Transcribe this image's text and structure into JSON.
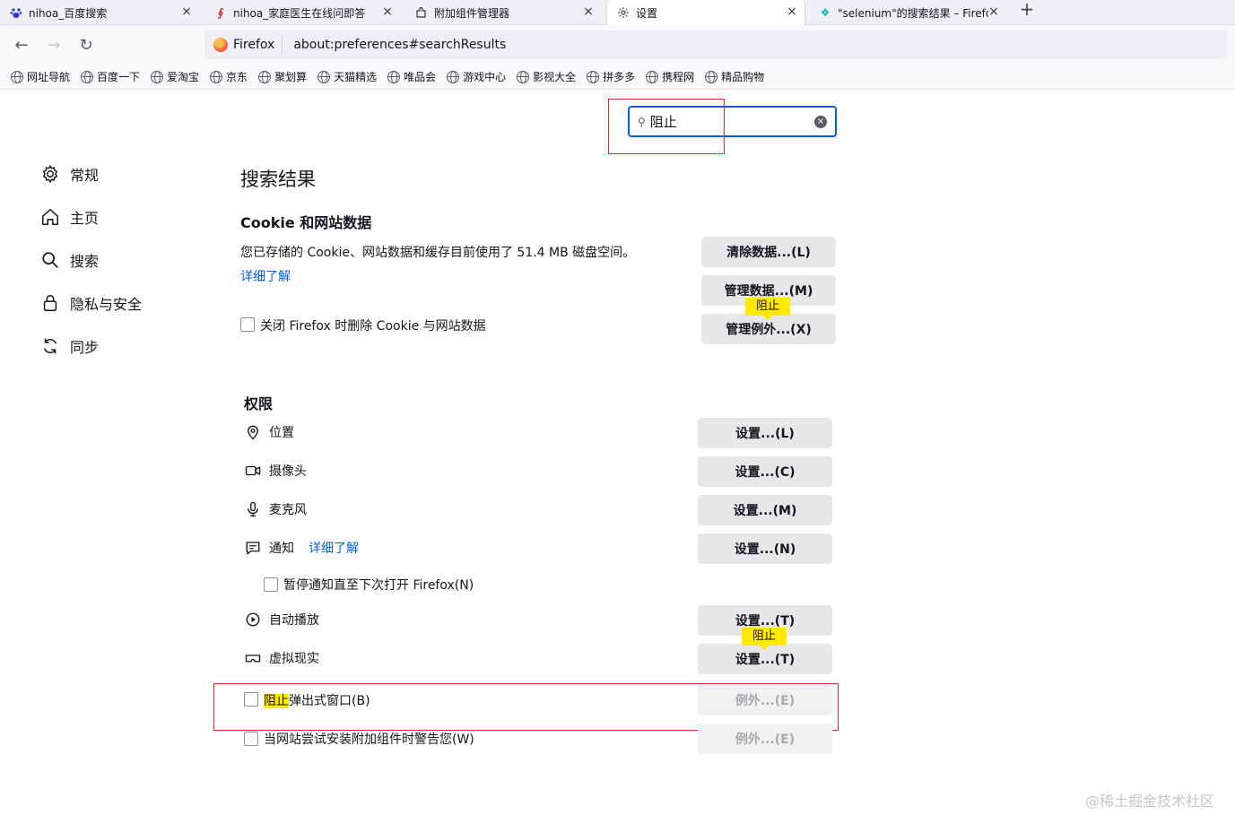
{
  "tabs": [
    {
      "title": "nihoa_百度搜索",
      "icon": "baidu-paw-icon"
    },
    {
      "title": "nihoa_家庭医生在线问即答",
      "icon": "family-doctor-icon"
    },
    {
      "title": "附加组件管理器",
      "icon": "puzzle-icon"
    },
    {
      "title": "设置",
      "icon": "gear-icon",
      "active": true
    },
    {
      "title": "\"selenium\"的搜索结果 – Firefo",
      "icon": "firefox-icon"
    }
  ],
  "urlbar": {
    "identity": "Firefox",
    "url": "about:preferences#searchResults"
  },
  "bookmarks": [
    "网址导航",
    "百度一下",
    "爱淘宝",
    "京东",
    "聚划算",
    "天猫精选",
    "唯品会",
    "游戏中心",
    "影视大全",
    "拼多多",
    "携程网",
    "精品购物"
  ],
  "search": {
    "value": "阻止"
  },
  "sidebar": [
    {
      "label": "常规",
      "icon": "gear-icon"
    },
    {
      "label": "主页",
      "icon": "home-icon"
    },
    {
      "label": "搜索",
      "icon": "search-icon"
    },
    {
      "label": "隐私与安全",
      "icon": "lock-icon"
    },
    {
      "label": "同步",
      "icon": "sync-icon"
    }
  ],
  "main": {
    "heading": "搜索结果",
    "cookies": {
      "title": "Cookie 和网站数据",
      "description": "您已存储的 Cookie、网站数据和缓存目前使用了 51.4 MB 磁盘空间。",
      "learn_more": "详细了解",
      "clear_button": "清除数据...(L)",
      "manage_button": "管理数据...(M)",
      "exceptions_button": "管理例外...(X)",
      "delete_on_close": "关闭 Firefox 时删除 Cookie 与网站数据"
    },
    "permissions": {
      "title": "权限",
      "location": {
        "label": "位置",
        "button": "设置...(L)"
      },
      "camera": {
        "label": "摄像头",
        "button": "设置...(C)"
      },
      "microphone": {
        "label": "麦克风",
        "button": "设置...(M)"
      },
      "notifications": {
        "label": "通知",
        "learn_more": "详细了解",
        "button": "设置...(N)"
      },
      "pause_notifications": "暂停通知直至下次打开 Firefox(N)",
      "autoplay": {
        "label": "自动播放",
        "button": "设置...(T)"
      },
      "vr": {
        "label": "虚拟现实",
        "button": "设置...(T)"
      },
      "block_popups": {
        "highlight": "阻止",
        "rest": "弹出式窗口(B)",
        "button": "例外...(E)"
      },
      "addon_warning": {
        "label": "当网站尝试安装附加组件时警告您(W)",
        "button": "例外...(E)"
      }
    },
    "tooltip": "阻止"
  },
  "watermark": "@稀土掘金技术社区"
}
